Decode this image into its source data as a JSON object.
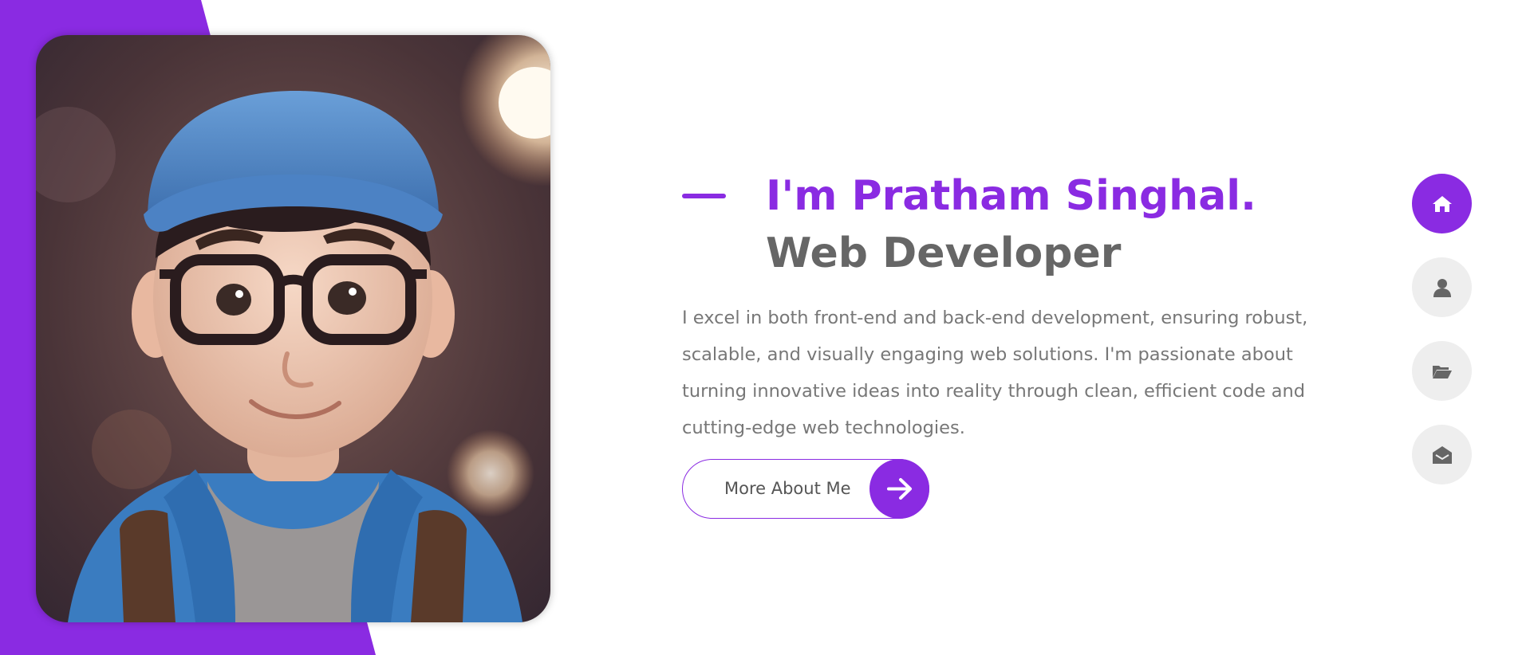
{
  "theme": {
    "accent": "#8a2be2",
    "text_dark": "#666666",
    "text_body": "#777777",
    "nav_inactive_bg": "#eeeeee",
    "nav_inactive_icon": "#666666",
    "nav_active_icon": "#ffffff"
  },
  "hero": {
    "portrait_alt": "3D cartoon portrait of a boy with blue cap and glasses",
    "name": "I'm Pratham Singhal.",
    "role": "Web Developer",
    "description": "I excel in both front-end and back-end development, ensuring robust, scalable, and visually engaging web solutions. I'm passionate about turning innovative ideas into reality through clean, efficient code and cutting-edge web technologies.",
    "cta_label": "More About Me",
    "cta_icon": "arrow-right-icon"
  },
  "nav": [
    {
      "icon": "home-icon",
      "active": true
    },
    {
      "icon": "user-icon",
      "active": false
    },
    {
      "icon": "folder-open-icon",
      "active": false
    },
    {
      "icon": "envelope-open-icon",
      "active": false
    }
  ]
}
